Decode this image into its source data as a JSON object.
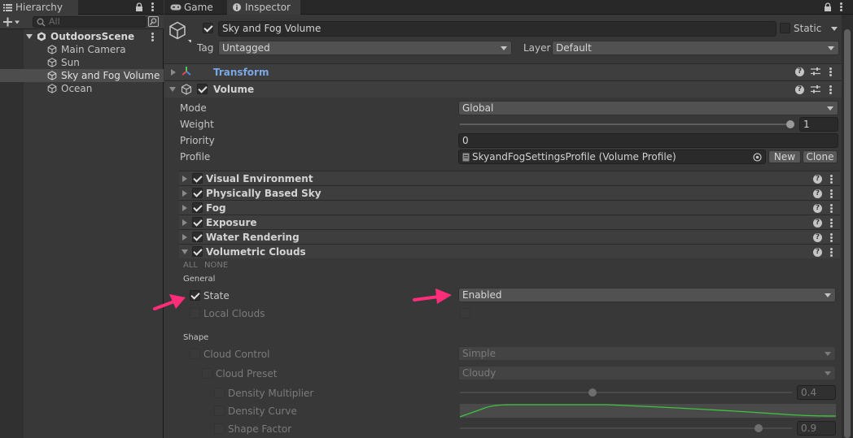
{
  "hierarchy": {
    "tab_label": "Hierarchy",
    "search_placeholder": "All",
    "scene": "OutdoorsScene",
    "items": [
      {
        "label": "Main Camera"
      },
      {
        "label": "Sun"
      },
      {
        "label": "Sky and Fog Volume"
      },
      {
        "label": "Ocean"
      }
    ]
  },
  "tabs": {
    "game": "Game",
    "inspector": "Inspector"
  },
  "object": {
    "name": "Sky and Fog Volume",
    "static_label": "Static",
    "tag_label": "Tag",
    "tag_value": "Untagged",
    "layer_label": "Layer",
    "layer_value": "Default"
  },
  "components": {
    "transform": "Transform",
    "volume": "Volume"
  },
  "volume": {
    "mode_label": "Mode",
    "mode_value": "Global",
    "weight_label": "Weight",
    "weight_value": "1",
    "weight_fraction": 1.0,
    "priority_label": "Priority",
    "priority_value": "0",
    "profile_label": "Profile",
    "profile_value": "SkyandFogSettingsProfile (Volume Profile)",
    "new_button": "New",
    "clone_button": "Clone"
  },
  "overrides": [
    {
      "label": "Visual Environment",
      "expanded": false
    },
    {
      "label": "Physically Based Sky",
      "expanded": false
    },
    {
      "label": "Fog",
      "expanded": false
    },
    {
      "label": "Exposure",
      "expanded": false
    },
    {
      "label": "Water Rendering",
      "expanded": false
    },
    {
      "label": "Volumetric Clouds",
      "expanded": true
    }
  ],
  "clouds": {
    "all_label": "ALL",
    "none_label": "NONE",
    "general_header": "General",
    "state_label": "State",
    "state_value": "Enabled",
    "local_clouds_label": "Local Clouds",
    "shape_header": "Shape",
    "cloud_control_label": "Cloud Control",
    "cloud_control_value": "Simple",
    "cloud_preset_label": "Cloud Preset",
    "cloud_preset_value": "Cloudy",
    "density_multiplier_label": "Density Multiplier",
    "density_multiplier_value": "0.4",
    "density_multiplier_fraction": 0.4,
    "density_curve_label": "Density Curve",
    "shape_factor_label": "Shape Factor",
    "shape_factor_value": "0.9",
    "shape_factor_fraction": 0.9
  },
  "colors": {
    "annotation_arrow": "#ff2d7a",
    "transform_label": "#7aa7e6",
    "curve": "#3ec43e"
  }
}
